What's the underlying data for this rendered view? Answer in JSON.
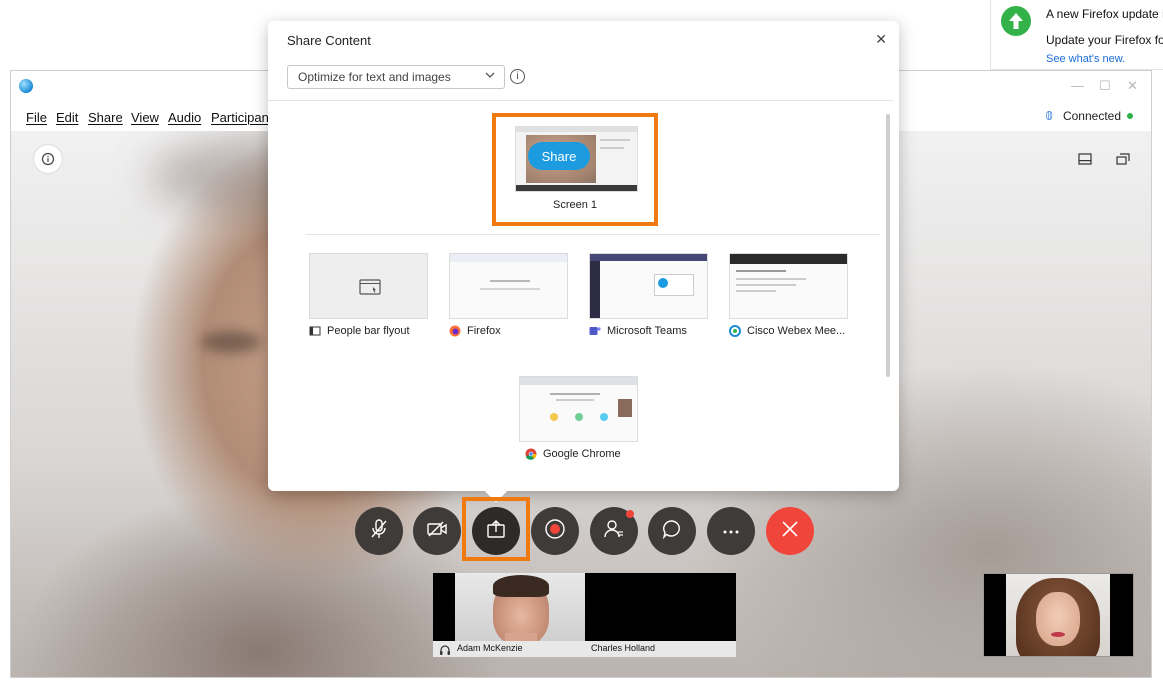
{
  "firefox_notification": {
    "line1": "A new Firefox update is",
    "line2": "Update your Firefox for",
    "link": "See what's new."
  },
  "app": {
    "menu": [
      "File",
      "Edit",
      "Share",
      "View",
      "Audio",
      "Participant"
    ],
    "status": "Connected"
  },
  "share_dialog": {
    "title": "Share Content",
    "optimize_value": "Optimize for text and images",
    "screen": {
      "button": "Share",
      "label": "Screen 1"
    },
    "apps": [
      {
        "label": "People bar flyout",
        "icon": "window-icon"
      },
      {
        "label": "Firefox",
        "icon": "firefox-icon"
      },
      {
        "label": "Microsoft Teams",
        "icon": "teams-icon"
      },
      {
        "label": "Cisco Webex Mee...",
        "icon": "webex-icon"
      },
      {
        "label": "Google Chrome",
        "icon": "chrome-icon"
      }
    ]
  },
  "toolbar": {
    "buttons": [
      "mute-icon",
      "video-off-icon",
      "share-icon",
      "record-icon",
      "participants-icon",
      "chat-icon",
      "more-icon",
      "end-call-icon"
    ]
  },
  "participants": [
    {
      "name": "Adam McKenzie"
    },
    {
      "name": "Charles Holland"
    }
  ],
  "colors": {
    "highlight": "#f07a10",
    "share_blue": "#1d9be0",
    "end_red": "#f0453a",
    "connected_green": "#2fb14a"
  }
}
